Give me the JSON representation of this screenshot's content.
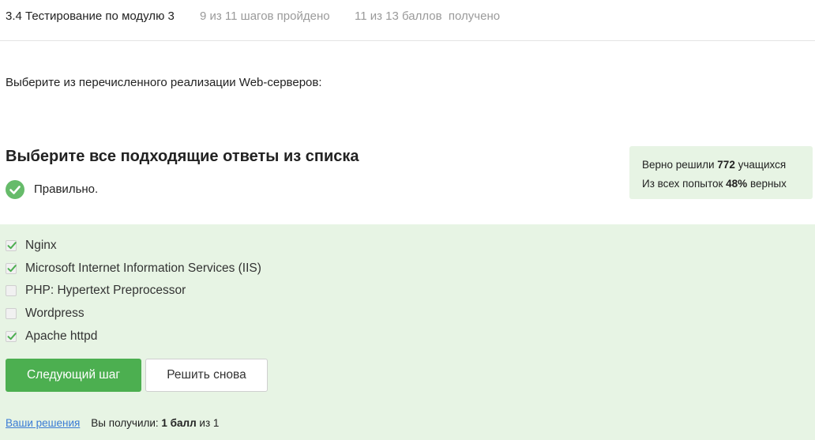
{
  "header": {
    "lesson_title": "3.4 Тестирование по модулю 3",
    "steps_progress": "9 из 11 шагов пройдено",
    "points_progress": "11 из 13 баллов  получено"
  },
  "question": {
    "text": "Выберите из перечисленного реализации Web-серверов:"
  },
  "instruction": "Выберите все подходящие ответы из списка",
  "result": {
    "icon": "check-circle-icon",
    "text": "Правильно.",
    "color": "#66bb6a"
  },
  "stats": {
    "line1_prefix": "Верно решили ",
    "solved_count": "772",
    "line1_suffix": " учащихся",
    "line2_prefix": "Из всех попыток ",
    "success_rate": "48%",
    "line2_suffix": " верных"
  },
  "options": [
    {
      "label": "Nginx",
      "checked": true
    },
    {
      "label": "Microsoft Internet Information Services (IIS)",
      "checked": true
    },
    {
      "label": "PHP: Hypertext Preprocessor",
      "checked": false
    },
    {
      "label": "Wordpress",
      "checked": false
    },
    {
      "label": "Apache httpd",
      "checked": true
    }
  ],
  "buttons": {
    "next_step": "Следующий шаг",
    "retry": "Решить снова"
  },
  "footer": {
    "solutions_link": "Ваши решения",
    "score_prefix": "Вы получили: ",
    "score_value": "1 балл",
    "score_suffix": " из 1"
  },
  "colors": {
    "panel_bg": "#e7f4e4",
    "primary_button": "#4caf50",
    "link": "#3a7bd5"
  }
}
